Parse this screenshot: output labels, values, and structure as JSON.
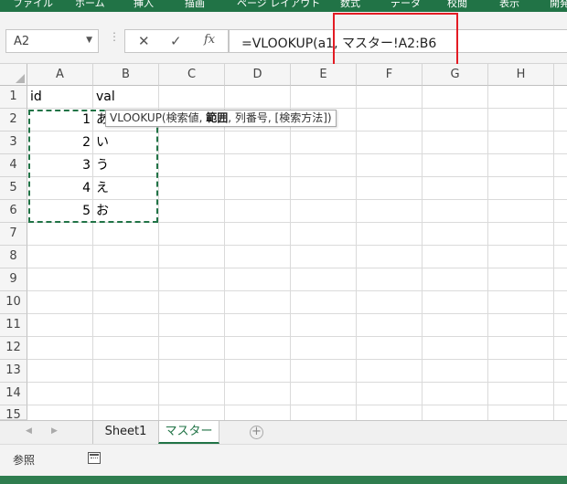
{
  "ribbon": {
    "tabs": [
      "ファイル",
      "ホーム",
      "挿入",
      "描画",
      "ページ レイアウト",
      "数式",
      "データ",
      "校閲",
      "表示",
      "開発"
    ]
  },
  "formula_bar": {
    "name_box": "A2",
    "cancel_icon": "✕",
    "enter_icon": "✓",
    "fx_icon": "fx",
    "formula": "=VLOOKUP(a1, マスター!A2:B6"
  },
  "columns": [
    "A",
    "B",
    "C",
    "D",
    "E",
    "F",
    "G",
    "H"
  ],
  "rows": [
    "1",
    "2",
    "3",
    "4",
    "5",
    "6",
    "7",
    "8",
    "9",
    "10",
    "11",
    "12",
    "13",
    "14",
    "15"
  ],
  "cells": {
    "A1": "id",
    "B1": "val",
    "A2": "1",
    "B2": "あ",
    "A3": "2",
    "B3": "い",
    "A4": "3",
    "B4": "う",
    "A5": "4",
    "B5": "え",
    "A6": "5",
    "B6": "お"
  },
  "tooltip": {
    "func": "VLOOKUP(",
    "arg1": "検索値, ",
    "arg2": "範囲",
    "rest": ", 列番号, [検索方法])"
  },
  "sheet_tabs": [
    "Sheet1",
    "マスター"
  ],
  "active_sheet": "マスター",
  "status": {
    "mode": "参照"
  },
  "colors": {
    "accent": "#217346",
    "highlight": "#e31b23"
  }
}
